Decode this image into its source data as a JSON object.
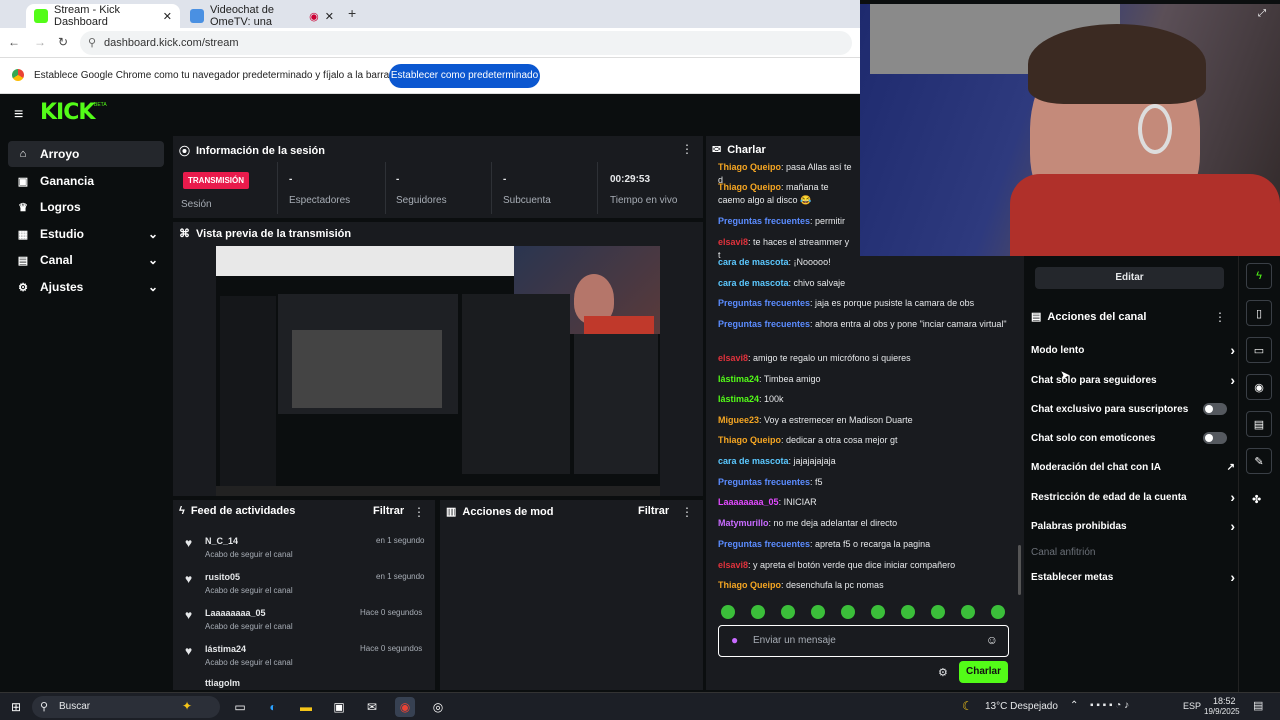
{
  "browser": {
    "tabs": [
      {
        "title": "Stream - Kick Dashboard",
        "active": true
      },
      {
        "title": "Videochat de OmeTV: una",
        "active": false
      }
    ],
    "url": "dashboard.kick.com/stream",
    "infobar_text": "Establece Google Chrome como tu navegador predeterminado y fíjalo a la barra de tareas",
    "infobar_button": "Establecer como predeterminado"
  },
  "kick": {
    "logo": "KICK",
    "logo_badge": "BETA",
    "sidebar": [
      {
        "label": "Arroyo",
        "icon": "home-icon",
        "active": true
      },
      {
        "label": "Ganancia",
        "icon": "wallet-icon"
      },
      {
        "label": "Logros",
        "icon": "trophy-icon"
      },
      {
        "label": "Estudio",
        "icon": "grid-icon",
        "expand": true
      },
      {
        "label": "Canal",
        "icon": "channel-icon",
        "expand": true
      },
      {
        "label": "Ajustes",
        "icon": "gear-icon",
        "expand": true
      }
    ],
    "session": {
      "title": "Información de la sesión",
      "badge": "TRANSMISIÓN",
      "badge_label": "Sesión",
      "stats": [
        {
          "value": "-",
          "label": "Espectadores"
        },
        {
          "value": "-",
          "label": "Seguidores"
        },
        {
          "value": "-",
          "label": "Subcuenta"
        },
        {
          "value": "00:29:53",
          "label": "Tiempo en vivo"
        }
      ]
    },
    "preview": {
      "title": "Vista previa de la transmisión"
    },
    "feed": {
      "title": "Feed de actividades",
      "filter": "Filtrar",
      "items": [
        {
          "user": "N_C_14",
          "text": "Acabo de seguir el canal",
          "time": "en 1 segundo"
        },
        {
          "user": "rusito05",
          "text": "Acabo de seguir el canal",
          "time": "en 1 segundo"
        },
        {
          "user": "Laaaaaaaa_05",
          "text": "Acabo de seguir el canal",
          "time": "Hace 0 segundos"
        },
        {
          "user": "lástima24",
          "text": "Acabo de seguir el canal",
          "time": "Hace 0 segundos"
        },
        {
          "user": "ttiagolm",
          "text": "",
          "time": ""
        }
      ]
    },
    "mod": {
      "title": "Acciones de mod",
      "filter": "Filtrar"
    },
    "chat": {
      "title": "Charlar",
      "messages": [
        {
          "user": "Thiago Queipo",
          "color": "#f5a623",
          "text": "pasa Allas así te d"
        },
        {
          "user": "Thiago Queipo",
          "color": "#f5a623",
          "text": "mañana te caemo algo al disco 😂"
        },
        {
          "user": "Preguntas frecuentes",
          "color": "#5b8cff",
          "text": "permitir"
        },
        {
          "user": "elsavi8",
          "color": "#e0323c",
          "text": "te haces el streammer y t"
        },
        {
          "user": "cara de mascota",
          "color": "#5bc8ff",
          "text": "¡Nooooo!"
        },
        {
          "user": "cara de mascota",
          "color": "#5bc8ff",
          "text": "chivo salvaje"
        },
        {
          "user": "Preguntas frecuentes",
          "color": "#5b8cff",
          "text": "jaja es porque pusiste la camara de obs"
        },
        {
          "user": "Preguntas frecuentes",
          "color": "#5b8cff",
          "text": "ahora entra al obs y pone \"inciar camara virtual\""
        },
        {
          "user": "elsavi8",
          "color": "#e0323c",
          "text": "amigo te regalo un micrófono si quieres"
        },
        {
          "user": "lástima24",
          "color": "#53fc18",
          "text": "Timbea amigo"
        },
        {
          "user": "lástima24",
          "color": "#53fc18",
          "text": "100k"
        },
        {
          "user": "Miguee23",
          "color": "#f5a623",
          "text": "Voy a estremecer en Madison Duarte"
        },
        {
          "user": "Thiago Queipo",
          "color": "#f5a623",
          "text": "dedicar a otra cosa mejor gt"
        },
        {
          "user": "cara de mascota",
          "color": "#5bc8ff",
          "text": "jajajajajaja"
        },
        {
          "user": "Preguntas frecuentes",
          "color": "#5b8cff",
          "text": "f5"
        },
        {
          "user": "Laaaaaaaa_05",
          "color": "#e24bff",
          "text": "INICIAR"
        },
        {
          "user": "Matymurillo",
          "color": "#c86bff",
          "text": "no me deja adelantar el directo"
        },
        {
          "user": "Preguntas frecuentes",
          "color": "#5b8cff",
          "text": "apreta f5 o recarga la pagina"
        },
        {
          "user": "elsavi8",
          "color": "#e0323c",
          "text": "y apreta el botón verde que dice iniciar compañero"
        },
        {
          "user": "Thiago Queipo",
          "color": "#f5a623",
          "text": "desenchufa la pc nomas"
        }
      ],
      "placeholder": "Enviar un mensaje",
      "send": "Charlar"
    },
    "actions": {
      "edit": "Editar",
      "title": "Acciones del canal",
      "items": [
        {
          "label": "Modo lento",
          "type": "chevron"
        },
        {
          "label": "Chat solo para seguidores",
          "type": "chevron"
        },
        {
          "label": "Chat exclusivo para suscriptores",
          "type": "toggle"
        },
        {
          "label": "Chat solo con emoticones",
          "type": "toggle"
        },
        {
          "label": "Moderación del chat con IA",
          "type": "external"
        },
        {
          "label": "Restricción de edad de la cuenta",
          "type": "chevron"
        },
        {
          "label": "Palabras prohibidas",
          "type": "chevron"
        },
        {
          "label": "Canal anfitrión",
          "type": "disabled"
        },
        {
          "label": "Establecer metas",
          "type": "chevron"
        }
      ]
    }
  },
  "taskbar": {
    "search": "Buscar",
    "weather": "13°C Despejado",
    "lang": "ESP",
    "time": "18:52",
    "date": "19/9/2025"
  }
}
